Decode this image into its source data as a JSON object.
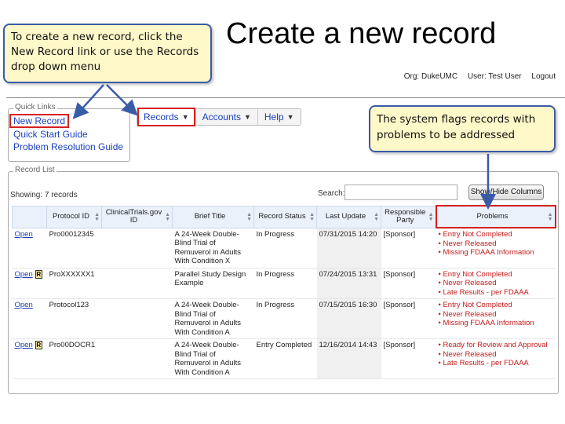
{
  "slide": {
    "title": "Create a new record",
    "callout_left": "To create a new record, click the New Record link or use the Records drop down menu",
    "callout_right": "The system flags records with problems to be addressed"
  },
  "user_bar": {
    "org": "Org: DukeUMC",
    "user": "User: Test User",
    "logout": "Logout"
  },
  "quick_links": {
    "legend": "Quick Links",
    "items": [
      "New Record",
      "Quick Start Guide",
      "Problem Resolution Guide"
    ]
  },
  "menu": {
    "items": [
      "Records",
      "Accounts",
      "Help"
    ]
  },
  "record_list": {
    "legend": "Record List",
    "showing": "Showing: 7 records",
    "search_label": "Search:",
    "search_value": "",
    "show_hide_label": "Show/Hide Columns",
    "columns": [
      "",
      "Protocol ID",
      "ClinicalTrials.gov ID",
      "Brief Title",
      "Record Status",
      "Last Update",
      "Responsible Party",
      "Problems"
    ],
    "rows": [
      {
        "open": "Open",
        "has_icon": false,
        "protocol_id": "Pro00012345",
        "ct_id": "",
        "title": "A 24-Week Double-Blind Trial of Remuverol in Adults With Condition X",
        "status": "In Progress",
        "updated": "07/31/2015 14:20",
        "party": "[Sponsor]",
        "problems": [
          "• Entry Not Completed",
          "• Never Released",
          "• Missing FDAAA Information"
        ]
      },
      {
        "open": "Open",
        "has_icon": true,
        "icon_letter": "R",
        "protocol_id": "ProXXXXXX1",
        "ct_id": "",
        "title": "Parallel Study Design Example",
        "status": "In Progress",
        "updated": "07/24/2015 13:31",
        "party": "[Sponsor]",
        "problems": [
          "• Entry Not Completed",
          "• Never Released",
          "• Late Results - per FDAAA"
        ]
      },
      {
        "open": "Open",
        "has_icon": false,
        "protocol_id": "Protocol123",
        "ct_id": "",
        "title": "A 24-Week Double-Blind Trial of Remuverol in Adults With Condition A",
        "status": "In Progress",
        "updated": "07/15/2015 16:30",
        "party": "[Sponsor]",
        "problems": [
          "• Entry Not Completed",
          "• Never Released",
          "• Missing FDAAA Information"
        ]
      },
      {
        "open": "Open",
        "has_icon": true,
        "icon_letter": "R",
        "protocol_id": "Pro00DOCR1",
        "ct_id": "",
        "title": "A 24-Week Double-Blind Trial of Remuverol in Adults With Condition A",
        "status": "Entry Completed",
        "updated": "12/16/2014 14:43",
        "party": "[Sponsor]",
        "problems": [
          "• Ready for Review and Approval",
          "• Never Released",
          "• Late Results - per FDAAA"
        ]
      }
    ]
  },
  "colors": {
    "callout_fill": "#fff8c9",
    "callout_border": "#3a5ba8",
    "highlight_red": "#d61f1f",
    "link_blue": "#1a3fbf",
    "problem_red": "#c51a1a"
  }
}
